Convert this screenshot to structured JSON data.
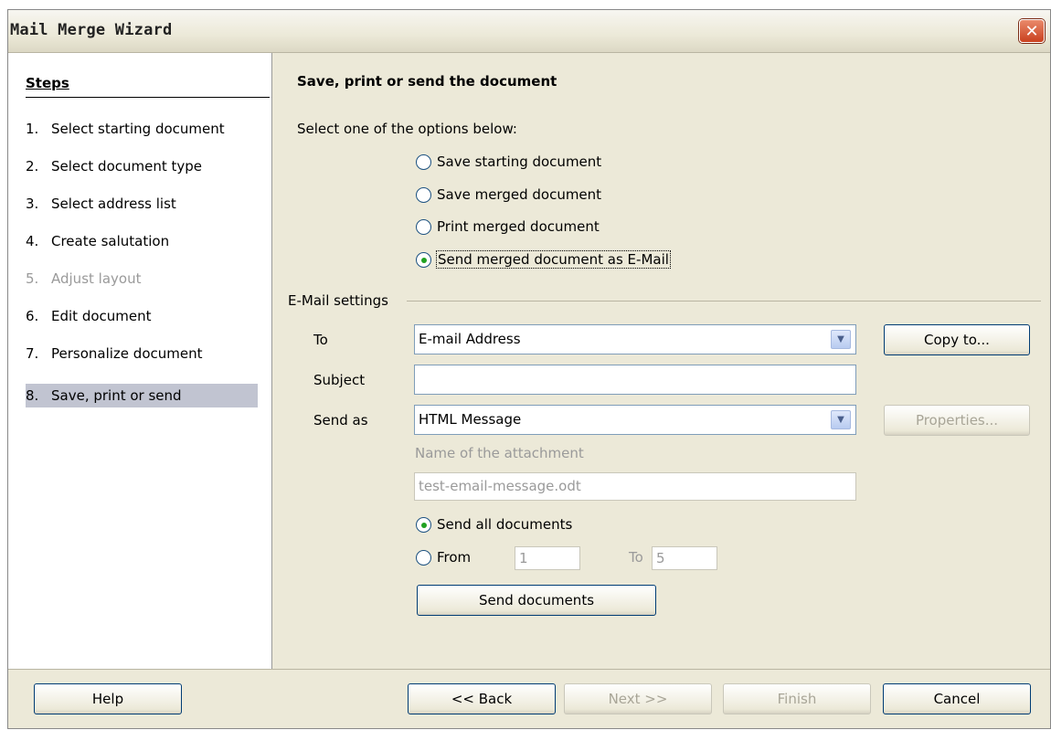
{
  "window": {
    "title": "Mail Merge Wizard"
  },
  "steps": {
    "header": "Steps",
    "items": [
      {
        "num": "1.",
        "label": "Select starting document",
        "state": "normal"
      },
      {
        "num": "2.",
        "label": "Select document type",
        "state": "normal"
      },
      {
        "num": "3.",
        "label": "Select address list",
        "state": "normal"
      },
      {
        "num": "4.",
        "label": "Create salutation",
        "state": "normal"
      },
      {
        "num": "5.",
        "label": "Adjust layout",
        "state": "disabled"
      },
      {
        "num": "6.",
        "label": "Edit document",
        "state": "normal"
      },
      {
        "num": "7.",
        "label": "Personalize document",
        "state": "normal"
      },
      {
        "num": "8.",
        "label": "Save, print or send",
        "state": "selected"
      }
    ]
  },
  "main": {
    "heading": "Save, print or send the document",
    "subheading": "Select one of the options below:",
    "options": [
      {
        "label": "Save starting document",
        "checked": false
      },
      {
        "label": "Save merged document",
        "checked": false
      },
      {
        "label": "Print merged document",
        "checked": false
      },
      {
        "label": "Send merged document as E-Mail",
        "checked": true
      }
    ],
    "email_group": "E-Mail settings",
    "to": {
      "label": "To",
      "value": "E-mail Address"
    },
    "copy_to_button": "Copy to...",
    "subject": {
      "label": "Subject",
      "value": ""
    },
    "send_as": {
      "label": "Send as",
      "value": "HTML Message"
    },
    "properties_button": "Properties...",
    "attachment": {
      "label": "Name of the attachment",
      "value": "test-email-message.odt"
    },
    "send_all": {
      "label": "Send all documents",
      "checked": true
    },
    "range": {
      "from_label": "From",
      "from_value": "1",
      "to_label": "To",
      "to_value": "5",
      "checked": false
    },
    "send_documents_button": "Send documents"
  },
  "footer": {
    "help": "Help",
    "back": "<< Back",
    "next": "Next >>",
    "finish": "Finish",
    "cancel": "Cancel"
  }
}
